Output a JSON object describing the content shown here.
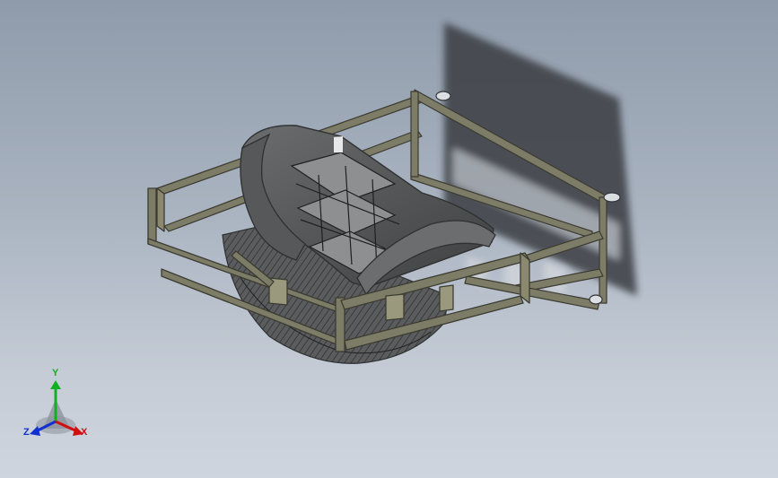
{
  "viewport": {
    "background_top": "#8f9bab",
    "background_bottom": "#cfd5de"
  },
  "model": {
    "frame_color": "#7d7c66",
    "frame_dark": "#3c3b32",
    "shell_color": "#5b5d5e",
    "shell_dark": "#2e3031",
    "shadow_color": "#3a3d42"
  },
  "triad": {
    "x_label": "X",
    "y_label": "Y",
    "z_label": "Z",
    "x_color": "#d01010",
    "y_color": "#10b020",
    "z_color": "#1030d0"
  }
}
